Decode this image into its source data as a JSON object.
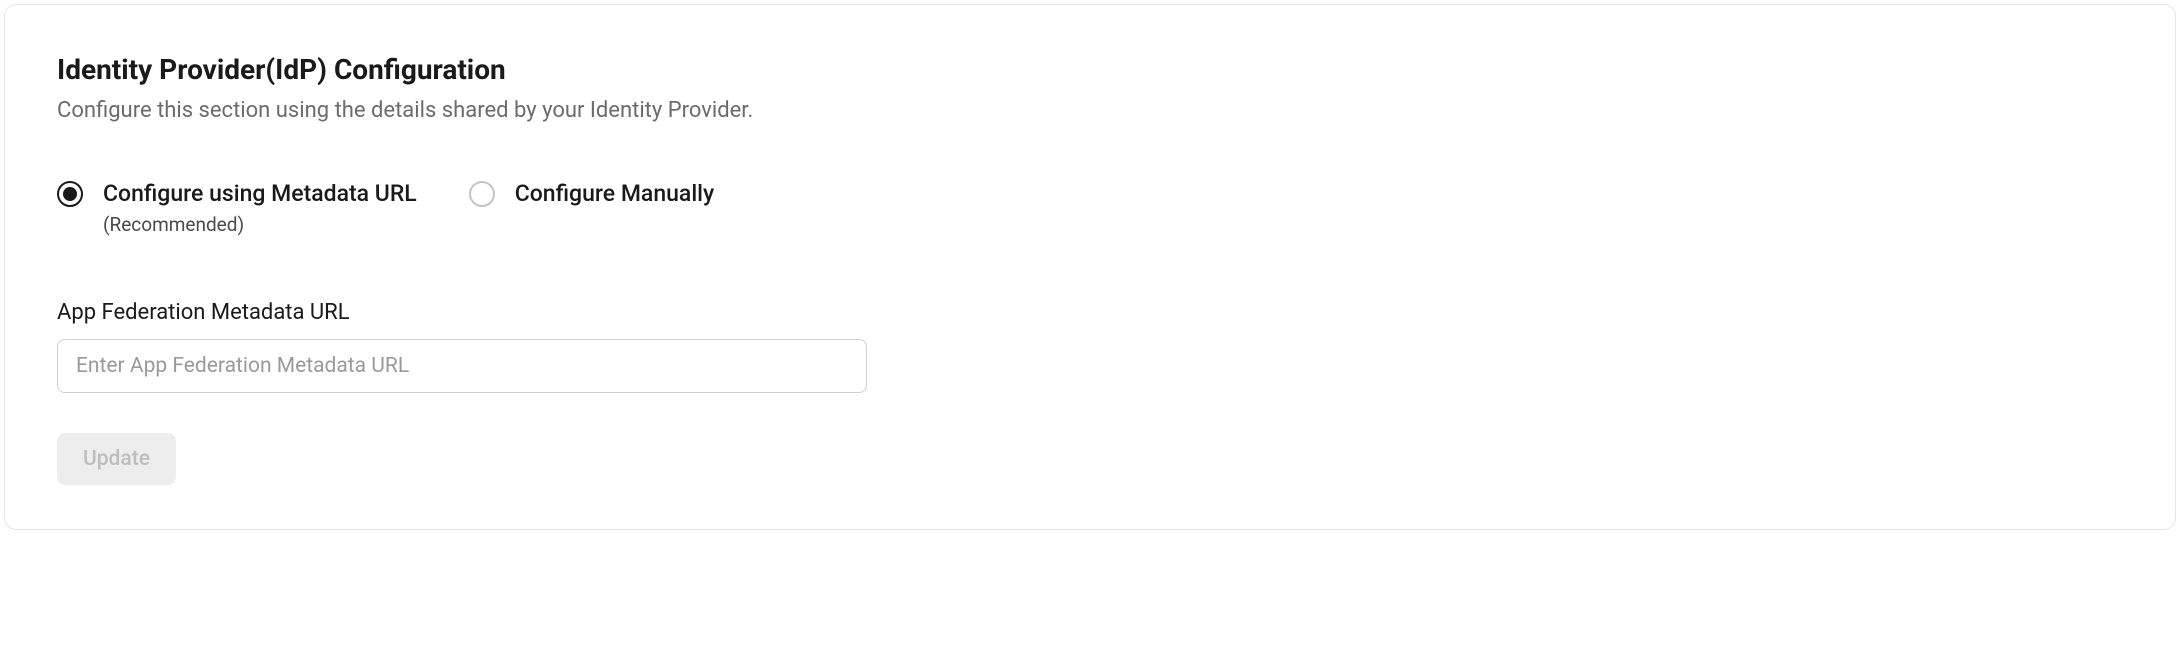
{
  "header": {
    "title": "Identity Provider(IdP) Configuration",
    "subtitle": "Configure this section using the details shared by your Identity Provider."
  },
  "radios": {
    "option1": {
      "label": "Configure using Metadata URL",
      "sublabel": "(Recommended)",
      "selected": true
    },
    "option2": {
      "label": "Configure Manually",
      "selected": false
    }
  },
  "field": {
    "label": "App Federation Metadata URL",
    "placeholder": "Enter App Federation Metadata URL",
    "value": ""
  },
  "button": {
    "update_label": "Update"
  }
}
